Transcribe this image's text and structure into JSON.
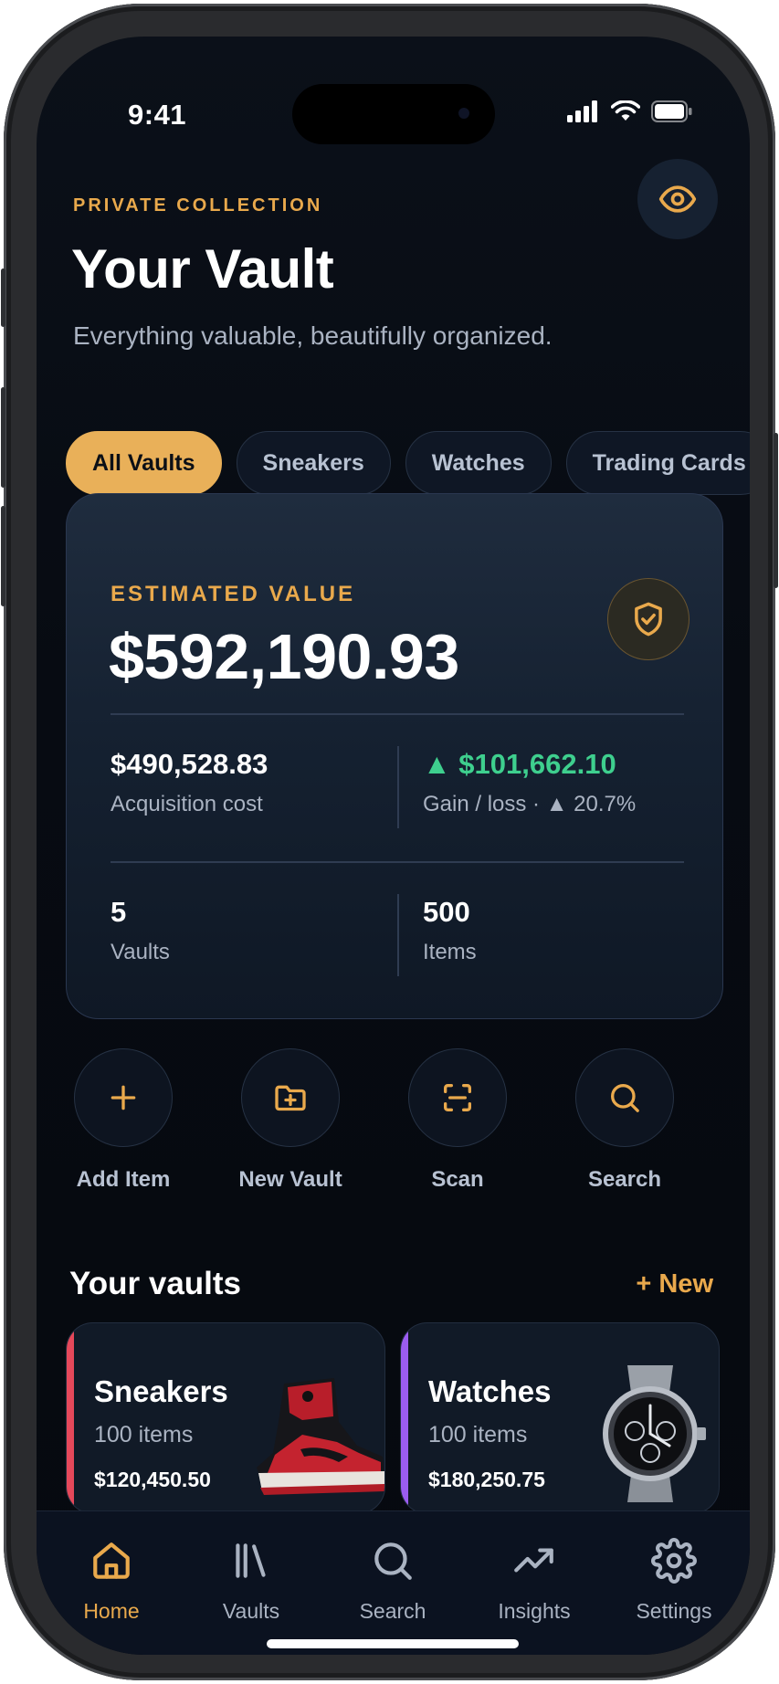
{
  "status": {
    "time": "9:41"
  },
  "header": {
    "eyebrow": "PRIVATE COLLECTION",
    "title": "Your Vault",
    "subtitle": "Everything valuable, beautifully organized."
  },
  "filters": [
    {
      "label": "All Vaults",
      "active": true
    },
    {
      "label": "Sneakers"
    },
    {
      "label": "Watches"
    },
    {
      "label": "Trading Cards"
    }
  ],
  "summary": {
    "eyebrow": "ESTIMATED VALUE",
    "total": "$592,190.93",
    "acquisition_value": "$490,528.83",
    "acquisition_label": "Acquisition cost",
    "gain_value": "▲ $101,662.10",
    "gain_label": "Gain / loss · ▲ 20.7%",
    "vaults_value": "5",
    "vaults_label": "Vaults",
    "items_value": "500",
    "items_label": "Items"
  },
  "actions": [
    {
      "label": "Add Item",
      "icon": "plus-icon"
    },
    {
      "label": "New Vault",
      "icon": "folder-plus-icon"
    },
    {
      "label": "Scan",
      "icon": "scan-icon"
    },
    {
      "label": "Search",
      "icon": "search-icon"
    }
  ],
  "vaults_section": {
    "title": "Your vaults",
    "action": "+ New"
  },
  "vaults": [
    {
      "name": "Sneakers",
      "count": "100 items",
      "value": "$120,450.50",
      "accent": "#e5485a",
      "image": "sneaker-image"
    },
    {
      "name": "Watches",
      "count": "100 items",
      "value": "$180,250.75",
      "accent": "#9b5cf0",
      "image": "watch-image"
    }
  ],
  "tabbar": [
    {
      "label": "Home",
      "icon": "home-icon",
      "active": true
    },
    {
      "label": "Vaults",
      "icon": "library-icon"
    },
    {
      "label": "Search",
      "icon": "search-icon"
    },
    {
      "label": "Insights",
      "icon": "trending-up-icon"
    },
    {
      "label": "Settings",
      "icon": "gear-icon"
    }
  ],
  "colors": {
    "accent": "#e9a94c",
    "gain": "#3ecf8e",
    "background": "#070b12"
  }
}
